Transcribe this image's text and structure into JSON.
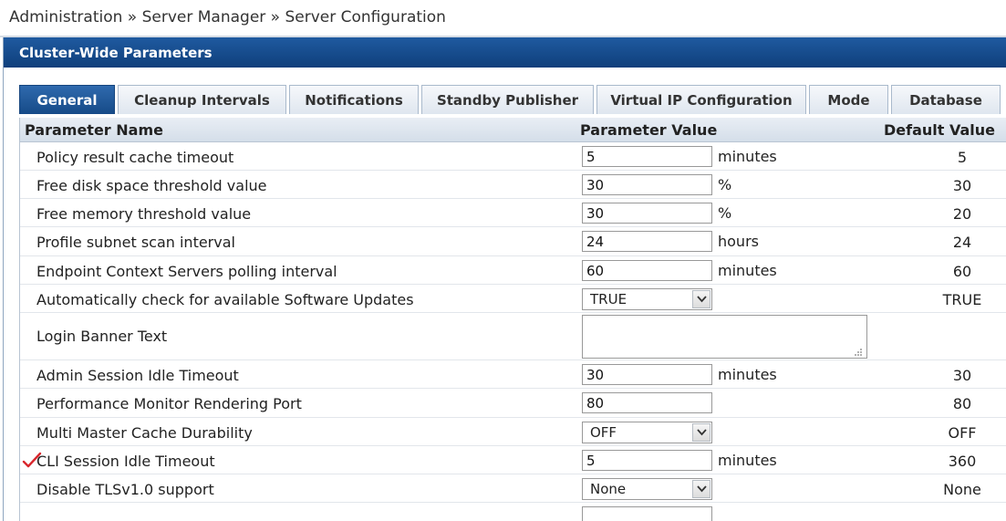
{
  "breadcrumb": "Administration » Server Manager » Server Configuration",
  "panel": {
    "title": "Cluster-Wide Parameters"
  },
  "tabs": [
    {
      "label": "General",
      "active": true
    },
    {
      "label": "Cleanup Intervals"
    },
    {
      "label": "Notifications"
    },
    {
      "label": "Standby Publisher"
    },
    {
      "label": "Virtual IP Configuration"
    },
    {
      "label": "Mode"
    },
    {
      "label": "Database"
    }
  ],
  "table": {
    "headers": {
      "name": "Parameter Name",
      "value": "Parameter Value",
      "default": "Default Value"
    },
    "rows": [
      {
        "name": "Policy result cache timeout",
        "type": "text",
        "value": "5",
        "unit": "minutes",
        "default": "5"
      },
      {
        "name": "Free disk space threshold value",
        "type": "text",
        "value": "30",
        "unit": "%",
        "default": "30"
      },
      {
        "name": "Free memory threshold value",
        "type": "text",
        "value": "30",
        "unit": "%",
        "default": "20"
      },
      {
        "name": "Profile subnet scan interval",
        "type": "text",
        "value": "24",
        "unit": "hours",
        "default": "24"
      },
      {
        "name": "Endpoint Context Servers polling interval",
        "type": "text",
        "value": "60",
        "unit": "minutes",
        "default": "60"
      },
      {
        "name": "Automatically check for available Software Updates",
        "type": "select",
        "value": "TRUE",
        "unit": "",
        "default": "TRUE"
      },
      {
        "name": "Login Banner Text",
        "type": "textarea",
        "value": "",
        "unit": "",
        "default": ""
      },
      {
        "name": "Admin Session Idle Timeout",
        "type": "text",
        "value": "30",
        "unit": "minutes",
        "default": "30"
      },
      {
        "name": "Performance Monitor Rendering Port",
        "type": "text",
        "value": "80",
        "unit": "",
        "default": "80"
      },
      {
        "name": "Multi Master Cache Durability",
        "type": "select",
        "value": "OFF",
        "unit": "",
        "default": "OFF"
      },
      {
        "name": "CLI Session Idle Timeout",
        "type": "text",
        "value": "5",
        "unit": "minutes",
        "default": "360",
        "modified": true
      },
      {
        "name": "Disable TLSv1.0 support",
        "type": "select",
        "value": "None",
        "unit": "",
        "default": "None"
      }
    ]
  },
  "colors": {
    "header": "#1a4f8f",
    "tab_active": "#1f5a9b",
    "check": "#d9262c"
  }
}
